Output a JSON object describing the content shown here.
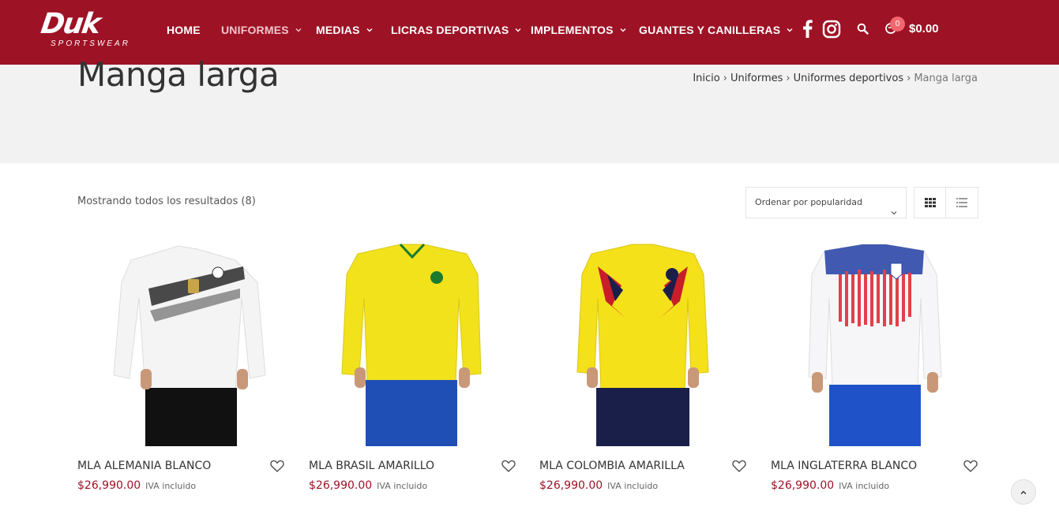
{
  "brand": {
    "logo_text": "Duk",
    "logo_subtext": "SPORTSWEAR",
    "header_color": "#9e1226"
  },
  "nav": {
    "items": [
      {
        "label": "HOME",
        "has_dropdown": false,
        "active": false
      },
      {
        "label": "UNIFORMES",
        "has_dropdown": true,
        "active": true
      },
      {
        "label": "MEDIAS",
        "has_dropdown": true,
        "active": false
      },
      {
        "label": "LICRAS DEPORTIVAS",
        "has_dropdown": true,
        "active": false
      },
      {
        "label": "IMPLEMENTOS",
        "has_dropdown": true,
        "active": false
      },
      {
        "label": "GUANTES Y CANILLERAS",
        "has_dropdown": true,
        "active": false
      }
    ],
    "social_icons": [
      "facebook-icon",
      "instagram-icon"
    ],
    "search_icon": "search-icon",
    "cart": {
      "icon": "cart-icon",
      "count": "0",
      "total": "$0.00"
    }
  },
  "page": {
    "title": "Manga larga",
    "breadcrumb": [
      {
        "label": "Inicio"
      },
      {
        "label": "Uniformes"
      },
      {
        "label": "Uniformes deportivos"
      },
      {
        "label": "Manga larga"
      }
    ]
  },
  "toolbar": {
    "result_count": "Mostrando todos los resultados (8)",
    "sort_selected": "Ordenar por popularidad",
    "view_modes": [
      "grid-view-icon",
      "list-view-icon"
    ]
  },
  "products": [
    {
      "name": "MLA ALEMANIA BLANCO",
      "price": "$26,990.00",
      "tax_note": "IVA incluido",
      "shirt_color": "#f4f4f4",
      "shorts_color": "#111111",
      "accent_color": "#222222"
    },
    {
      "name": "MLA BRASIL AMARILLO",
      "price": "$26,990.00",
      "tax_note": "IVA incluido",
      "shirt_color": "#f2e21c",
      "shorts_color": "#1f4fb5",
      "accent_color": "#1a7a2e"
    },
    {
      "name": "MLA COLOMBIA AMARILLA",
      "price": "$26,990.00",
      "tax_note": "IVA incluido",
      "shirt_color": "#f5e11a",
      "shorts_color": "#1a1f4a",
      "accent_color": "#c81e2a"
    },
    {
      "name": "MLA INGLATERRA BLANCO",
      "price": "$26,990.00",
      "tax_note": "IVA incluido",
      "shirt_color": "#f6f6f8",
      "shorts_color": "#1f52c8",
      "accent_color": "#e2404a"
    }
  ]
}
